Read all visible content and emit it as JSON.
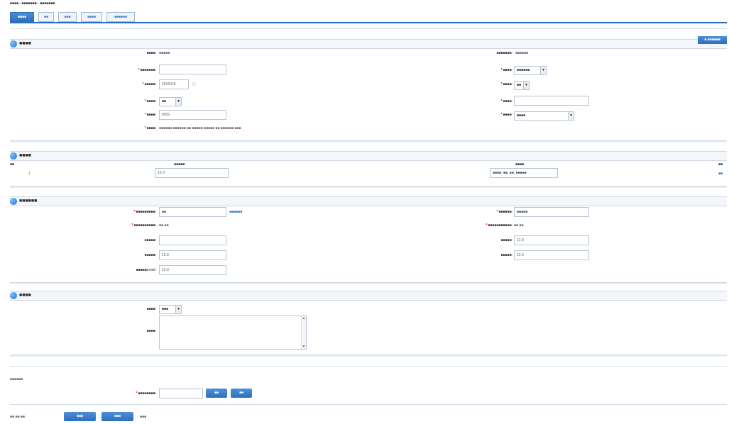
{
  "breadcrumb": "■■■■ › ■■■■■■■ › ■■■■■■■",
  "tabs": [
    "■■■■",
    "■■",
    "■■■",
    "■■■■",
    "■■■■■■"
  ],
  "colors": {
    "accent": "#2c6fbe",
    "required": "#e10000",
    "section_bg": "#f3f6fa"
  },
  "icons": {
    "section": "info-circle-icon",
    "calendar": "calendar-icon",
    "dropdown": "chevron-down-icon"
  },
  "basic": {
    "title": "■■■■",
    "add_button": "■ ■■■■■■",
    "row1": {
      "label": "■■■■:",
      "value": "■■■■■",
      "label2": "■■■■■■■:",
      "value2": "■■■■■■"
    },
    "row2": {
      "label": "■■■■■■■:",
      "value": "",
      "label2": "■■■■:",
      "value2": "■■■■■■"
    },
    "row3": {
      "label": "■■■■■:",
      "value": "2016078",
      "label2": "■■■■:",
      "value2": "■■"
    },
    "row4": {
      "label": "■■■■:",
      "value": "■■",
      "label2": "■■■■:",
      "value2": ""
    },
    "row5": {
      "label": "■■■■:",
      "value": "0010",
      "label2": "■■■■:",
      "value2": "■■■■"
    },
    "row6": {
      "label": "■■■■:",
      "value": "■■■■■■ ■■■■■■ ■■ ■■■■■ ■■■■■ ■■ ■■■■■■ ■■■"
    }
  },
  "detail": {
    "title": "■■■■",
    "columns": [
      "■■",
      "■■■■■",
      "■■■■",
      "■■"
    ],
    "rows": [
      {
        "no": "1",
        "code": "12.0",
        "name": "■■■■, ■■, ■■, ■■■■■",
        "op": "■■"
      }
    ]
  },
  "party": {
    "title": "■■■■■■",
    "row1": {
      "label": "■■■■■■■■■:",
      "value": "■■",
      "link": "■■■■■■",
      "label2": "■■■■■■:",
      "value2": "■■■■■"
    },
    "row2": {
      "label": "■■■■■■■■■■:",
      "value": "■■ ■■",
      "label2": "■■■■■■■■■■■:",
      "value2": "■■ ■■"
    },
    "row3": {
      "label": "■■■■■:",
      "value": "",
      "label2": "■■■■■:",
      "value2": "12.0"
    },
    "row4": {
      "label": "■■■■■:",
      "value": "12.0",
      "label2": "■■■■■:",
      "value2": "12.0"
    },
    "row5": {
      "label": "■■■■■email:",
      "value": "12.0"
    }
  },
  "other": {
    "title": "■■■■",
    "row1": {
      "label": "■■■■:",
      "value": "■■■"
    },
    "row2": {
      "label": "■■■■:"
    }
  },
  "attach": {
    "caption": "■■■■■■",
    "label": "■■■■■■■■:",
    "browse": "■■",
    "upload": "■■"
  },
  "footer": {
    "left": "■■ ■■ ■■",
    "prev": "■■■",
    "next": "■■■",
    "right": "■■■"
  }
}
